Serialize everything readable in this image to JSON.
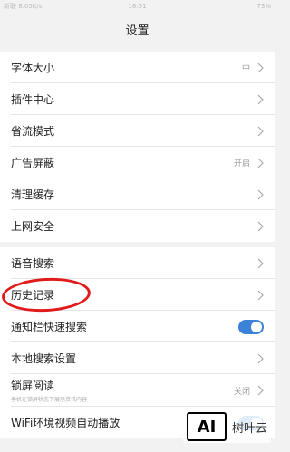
{
  "status_bar": {
    "left": "新联 8.05K/s",
    "time": "18:51",
    "battery": "73%"
  },
  "header": {
    "title": "设置"
  },
  "groups": [
    {
      "items": [
        {
          "label": "字体大小",
          "value": "中"
        },
        {
          "label": "插件中心",
          "value": ""
        },
        {
          "label": "省流模式",
          "value": ""
        },
        {
          "label": "广告屏蔽",
          "value": "开启"
        },
        {
          "label": "清理缓存",
          "value": ""
        },
        {
          "label": "上网安全",
          "value": ""
        }
      ]
    },
    {
      "items": [
        {
          "label": "语音搜索",
          "value": ""
        },
        {
          "label": "历史记录",
          "value": ""
        },
        {
          "label": "通知栏快速搜索",
          "toggle": true
        },
        {
          "label": "本地搜索设置",
          "value": ""
        },
        {
          "label": "锁屏阅读",
          "sublabel": "手机在锁屏状态下展示资讯内容",
          "value": "关闭"
        },
        {
          "label": "WiFi环境视频自动播放",
          "toggle": true
        }
      ]
    }
  ],
  "watermark": {
    "logo": "AI",
    "text": "树叶云"
  },
  "colors": {
    "accent": "#3b82d8",
    "annotation": "#e01b1b"
  }
}
